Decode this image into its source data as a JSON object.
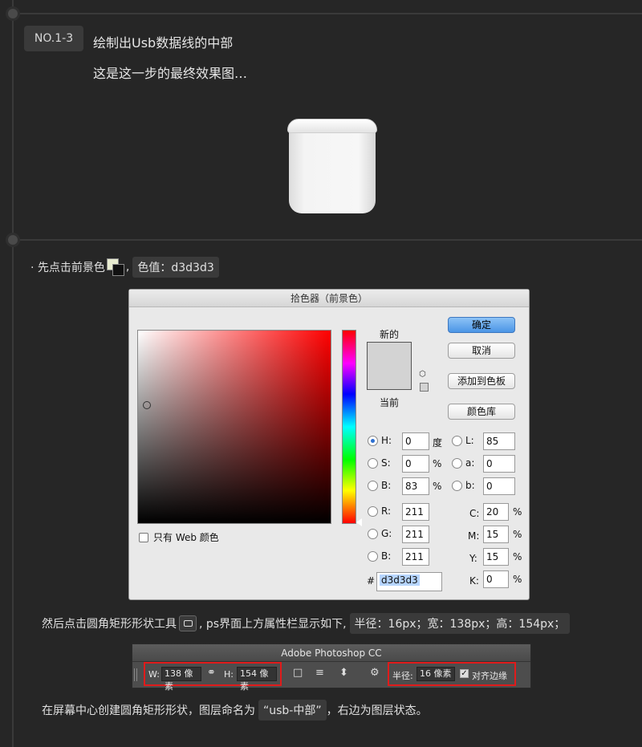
{
  "step": {
    "badge": "NO.1-3",
    "title": "绘制出Usb数据线的中部",
    "subtitle": "这是这一步的最终效果图…"
  },
  "note1": {
    "prefix": "· 先点击前景色",
    "comma": ",",
    "color_value": "色值：d3d3d3"
  },
  "picker": {
    "title": "拾色器（前景色）",
    "new_label": "新的",
    "current_label": "当前",
    "web_only_label": "只有 Web 颜色",
    "buttons": {
      "ok": "确定",
      "cancel": "取消",
      "add_swatch": "添加到色板",
      "libraries": "颜色库"
    },
    "fields": {
      "H": {
        "label": "H:",
        "value": "0",
        "unit": "度"
      },
      "S": {
        "label": "S:",
        "value": "0",
        "unit": "%"
      },
      "B": {
        "label": "B:",
        "value": "83",
        "unit": "%"
      },
      "R": {
        "label": "R:",
        "value": "211"
      },
      "G": {
        "label": "G:",
        "value": "211"
      },
      "Bl": {
        "label": "B:",
        "value": "211"
      },
      "L": {
        "label": "L:",
        "value": "85"
      },
      "a": {
        "label": "a:",
        "value": "0"
      },
      "b": {
        "label": "b:",
        "value": "0"
      },
      "C": {
        "label": "C:",
        "value": "20",
        "unit": "%"
      },
      "M": {
        "label": "M:",
        "value": "15",
        "unit": "%"
      },
      "Y": {
        "label": "Y:",
        "value": "15",
        "unit": "%"
      },
      "K": {
        "label": "K:",
        "value": "0",
        "unit": "%"
      }
    },
    "hash": "#",
    "hex": "d3d3d3",
    "color": "#d3d3d3"
  },
  "note2": {
    "prefix": "然后点击圆角矩形形状工具",
    "suffix": ", ps界面上方属性栏显示如下,",
    "props": "半径：16px；宽：138px；高：154px；"
  },
  "psbar": {
    "title": "Adobe Photoshop CC",
    "w_label": "W:",
    "w_value": "138 像素",
    "h_label": "H:",
    "h_value": "154 像素",
    "radius_label": "半径:",
    "radius_value": "16 像素",
    "align_label": "对齐边缘"
  },
  "note3": {
    "prefix": "在屏幕中心创建圆角矩形形状，图层命名为",
    "layer_name": "“usb-中部”",
    "suffix": "，右边为图层状态。"
  }
}
